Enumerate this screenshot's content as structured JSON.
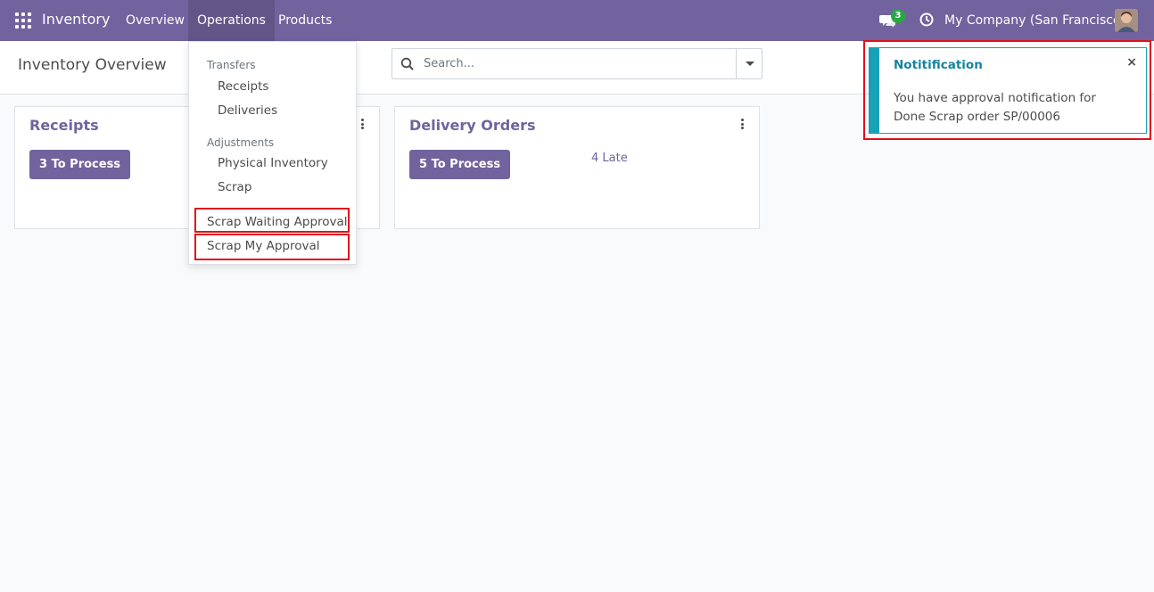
{
  "navbar": {
    "app_name": "Inventory",
    "menus": [
      "Overview",
      "Operations",
      "Products"
    ],
    "active_menu": "Operations",
    "chat_count": "3",
    "company": "My Company (San Francisco)",
    "bg_color": "#71639e"
  },
  "control_panel": {
    "title": "Inventory Overview",
    "search_placeholder": "Search..."
  },
  "cards": [
    {
      "title": "Receipts",
      "button": "3 To Process",
      "late": ""
    },
    {
      "title": "Delivery Orders",
      "button": "5 To Process",
      "late": "4 Late"
    }
  ],
  "dropdown": {
    "section_transfers": "Transfers",
    "transfers": [
      "Receipts",
      "Deliveries"
    ],
    "section_adjustments": "Adjustments",
    "adjustments": [
      "Physical Inventory",
      "Scrap"
    ],
    "extra": [
      "Scrap Waiting Approval",
      "Scrap My Approval"
    ]
  },
  "notification": {
    "title": "Notitification",
    "close": "×",
    "message": "You have approval notification for Done Scrap order SP/00006",
    "accent_color": "#17a2b8"
  },
  "highlight_color": "#e0111c"
}
